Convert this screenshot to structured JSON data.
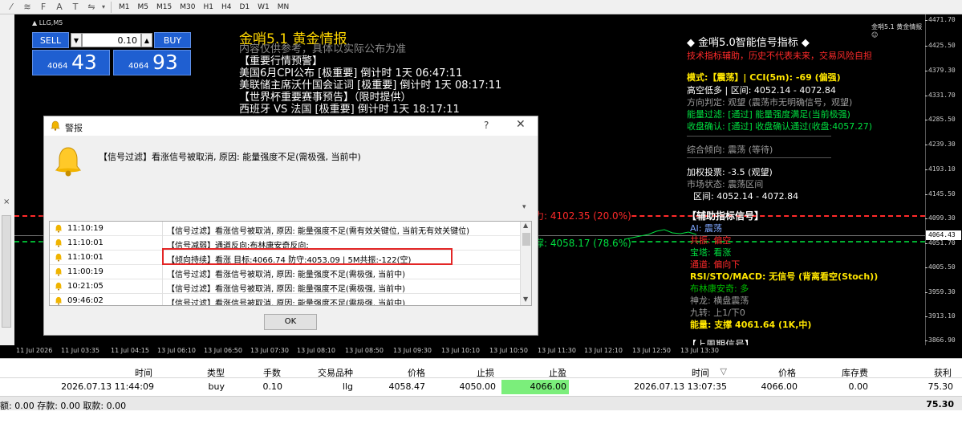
{
  "toolbar": {
    "timeframes": [
      "M1",
      "M5",
      "M15",
      "M30",
      "H1",
      "H4",
      "D1",
      "W1",
      "MN"
    ]
  },
  "chart": {
    "symbol_label": "▲ LLG,M5",
    "brand_small": "金哨5.1 黄金情报 ☺",
    "price_ticks": [
      "4471.70",
      "4425.50",
      "4379.30",
      "4331.70",
      "4285.50",
      "4239.30",
      "4193.10",
      "4145.50",
      "4099.30",
      "4051.70",
      "4005.50",
      "3959.30",
      "3913.10",
      "3866.90"
    ],
    "current_price": "4064.43",
    "time_labels": [
      "11 Jul 2026",
      "11 Jul 03:35",
      "11 Jul 04:15",
      "13 Jul 06:10",
      "13 Jul 06:50",
      "13 Jul 07:30",
      "13 Jul 08:10",
      "13 Jul 08:50",
      "13 Jul 09:30",
      "13 Jul 10:10",
      "13 Jul 10:50",
      "13 Jul 11:30",
      "13 Jul 12:10",
      "13 Jul 12:50",
      "13 Jul 13:30"
    ]
  },
  "trade_panel": {
    "sell_label": "SELL",
    "buy_label": "BUY",
    "lot_value": "0.10",
    "lot_down": "▼",
    "lot_up": "▲",
    "sell_small": "4064",
    "sell_big": "43",
    "buy_small": "4064",
    "buy_big": "93"
  },
  "info_center": {
    "title": "金哨5.1 黄金情报",
    "subtitle": "内容仅供参考，具体以实际公布为准",
    "section1": "【重要行情预警】",
    "line1": "美国6月CPI公布 [极重要] 倒计时 1天 06:47:11",
    "line2": "美联储主席沃什国会证词 [极重要] 倒计时 1天 08:17:11",
    "section2": "【世界杯重要赛事预告】（限时提供）",
    "line3": "西班牙 VS 法国 [极重要] 倒计时 1天 18:17:11"
  },
  "chart_lines": {
    "resistance_label": "阻力: 4102.35 (20.0%)",
    "support_label": "支撑: 4058.17 (78.6%)"
  },
  "indicator_panel": {
    "heading": "◆ 金哨5.0智能信号指标 ◆",
    "disclaimer": "技术指标辅助，历史不代表未来，交易风险自担",
    "mode_line": "模式:【震荡】| CCI(5m): -69 (偏强)",
    "range_line": "高空低多 | 区间: 4052.14 - 4072.84",
    "direction_line": "方向判定: 观望 (震荡市无明确信号，观望)",
    "energy_filter": "能量过滤: [通过] 能量强度满足(当前极强)",
    "close_confirm": "收盘确认: [通过] 收盘确认通过(收盘:4057.27)",
    "overall": "综合倾向: 震荡 (等待)",
    "weighted_vote": "加权投票: -3.5 (观望)",
    "market_state": "市场状态: 震荡区间",
    "range2": "区间: 4052.14 - 4072.84",
    "aux_heading": "【辅助指标信号】",
    "ai": "AI: 震荡",
    "ai_red": "共振: 偏空",
    "baota": "宝塔: 看涨",
    "channel": "通道: 偏向下",
    "rsi": "RSI/STO/MACD: 无信号 (背离看空(Stoch))",
    "boll": "布林康安奇: 多",
    "shenlong": "神龙: 横盘震荡",
    "jiuzhuan": "九转: 上1/下0",
    "energy": "能量: 支撑 4061.64 (1K,中)",
    "bottom_cut": "【上周期信号】"
  },
  "dialog": {
    "title": "警报",
    "help": "?",
    "close": "✕",
    "message": "【信号过滤】看涨信号被取消, 原因: 能量强度不足(需极强, 当前中)",
    "ok_label": "OK",
    "rows": [
      {
        "time": "11:10:19",
        "msg": "【信号过滤】看涨信号被取消, 原因: 能量强度不足(需有效关键位, 当前无有效关键位)"
      },
      {
        "time": "11:10:01",
        "msg": "【信号减弱】通道反向:布林康安奇反向;"
      },
      {
        "time": "11:10:01",
        "msg": "【倾向持续】看涨 目标:4066.74 防守:4053.09 | 5M共振:-122(空)"
      },
      {
        "time": "11:00:19",
        "msg": "【信号过滤】看涨信号被取消, 原因: 能量强度不足(需极强, 当前中)"
      },
      {
        "time": "10:21:05",
        "msg": "【信号过滤】看涨信号被取消, 原因: 能量强度不足(需极强, 当前中)"
      },
      {
        "time": "09:46:02",
        "msg": "【信号过滤】看涨信号被取消, 原因: 能量强度不足(需极强, 当前中)"
      }
    ]
  },
  "terminal": {
    "headers": {
      "time": "时间",
      "type": "类型",
      "lots": "手数",
      "symbol": "交易品种",
      "price": "价格",
      "sl": "止损",
      "tp": "止盈",
      "close_time": "时间",
      "sort_icon": "▽",
      "close_price": "价格",
      "swap": "库存费",
      "profit": "获利"
    },
    "row": {
      "time": "2026.07.13 11:44:09",
      "type": "buy",
      "lots": "0.10",
      "symbol": "llg",
      "price": "4058.47",
      "sl": "4050.00",
      "tp": "4066.00",
      "close_time": "2026.07.13 13:07:35",
      "close_price": "4066.00",
      "swap": "0.00",
      "profit": "75.30"
    },
    "summary": "额: 0.00  存款: 0.00  取款: 0.00",
    "summary_profit": "75.30"
  },
  "colors": {
    "chart_bg": "#000000",
    "button_blue": "#1f5fd1",
    "resistance": "#ff2a2a",
    "support": "#00e040",
    "highlight": "#e32626",
    "tp_green": "#7bee7b"
  }
}
